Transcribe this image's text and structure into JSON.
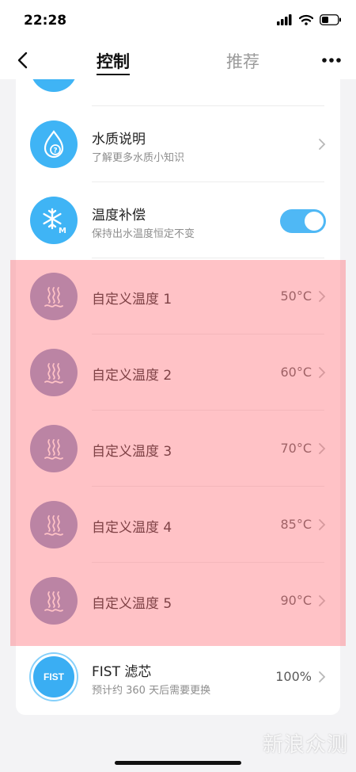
{
  "status": {
    "time": "22:28"
  },
  "nav": {
    "tab_active": "控制",
    "tab_inactive": "推荐"
  },
  "rows": {
    "water": {
      "title": "水质说明",
      "subtitle": "了解更多水质小知识"
    },
    "temp_comp": {
      "title": "温度补偿",
      "subtitle": "保持出水温度恒定不变",
      "toggle_on": true
    },
    "custom": [
      {
        "title": "自定义温度 1",
        "value": "50°C"
      },
      {
        "title": "自定义温度 2",
        "value": "60°C"
      },
      {
        "title": "自定义温度 3",
        "value": "70°C"
      },
      {
        "title": "自定义温度 4",
        "value": "85°C"
      },
      {
        "title": "自定义温度 5",
        "value": "90°C"
      }
    ],
    "filter": {
      "badge": "FIST",
      "title": "FIST 滤芯",
      "subtitle": "预计约 360 天后需要更换",
      "value": "100%"
    }
  },
  "colors": {
    "accent": "#3fb4f5",
    "highlight": "#ff6e78",
    "heat_icon_bg": "#8b94c5"
  },
  "watermark": "新浪众测"
}
